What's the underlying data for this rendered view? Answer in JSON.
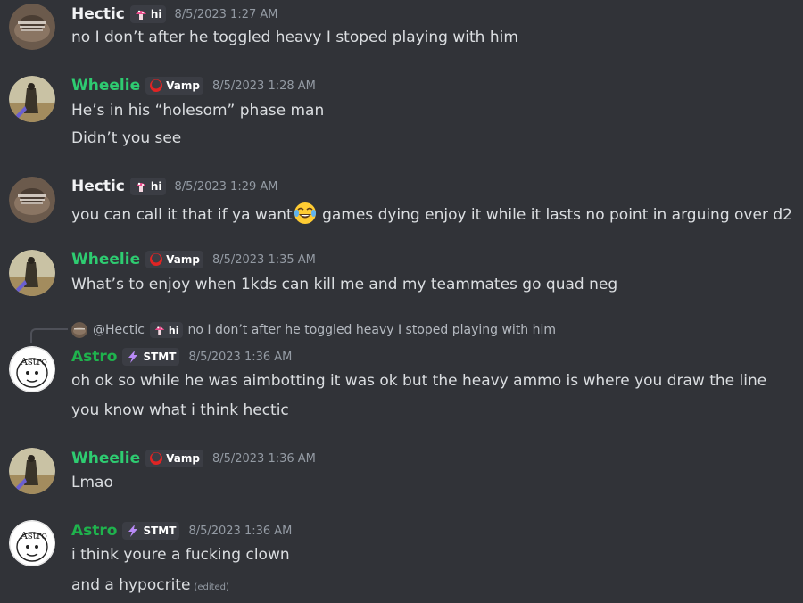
{
  "colors": {
    "background": "#313338",
    "hectic": "#f2f3f5",
    "wheelie": "#2ecc71",
    "astro": "#1fb34d",
    "text": "#dbdee1",
    "timestamp": "#949ba4"
  },
  "messages": [
    {
      "author": "Hectic",
      "role": "hi",
      "role_icon": "mushroom-icon",
      "timestamp": "8/5/2023 1:27 AM",
      "lines": [
        "no I don’t after he toggled heavy I stoped playing with him"
      ]
    },
    {
      "author": "Wheelie",
      "role": "Vamp",
      "role_icon": "vamp-icon",
      "timestamp": "8/5/2023 1:28 AM",
      "lines": [
        "He’s in his “holesom” phase man",
        "Didn’t you see"
      ]
    },
    {
      "author": "Hectic",
      "role": "hi",
      "role_icon": "mushroom-icon",
      "timestamp": "8/5/2023 1:29 AM",
      "line_before_emoji": "you can call it that if ya want",
      "emoji": "joy-emoji",
      "line_after_emoji": " games dying enjoy it while it lasts no point in arguing over d2"
    },
    {
      "author": "Wheelie",
      "role": "Vamp",
      "role_icon": "vamp-icon",
      "timestamp": "8/5/2023 1:35 AM",
      "lines": [
        "What’s to enjoy when 1kds can kill me and my teammates go quad neg"
      ]
    },
    {
      "reply": {
        "author": "@Hectic",
        "role": "hi",
        "text": "no I don’t after he toggled heavy I stoped playing with him"
      },
      "author": "Astro",
      "role": "STMT",
      "role_icon": "lightning-icon",
      "timestamp": "8/5/2023 1:36 AM",
      "lines": [
        "oh ok so while he was aimbotting it was ok but the heavy ammo is where you draw the line",
        "you know what i think hectic"
      ]
    },
    {
      "author": "Wheelie",
      "role": "Vamp",
      "role_icon": "vamp-icon",
      "timestamp": "8/5/2023 1:36 AM",
      "lines": [
        "Lmao"
      ]
    },
    {
      "author": "Astro",
      "role": "STMT",
      "role_icon": "lightning-icon",
      "timestamp": "8/5/2023 1:36 AM",
      "lines": [
        "i think youre a fucking clown",
        "and a hypocrite"
      ],
      "edited": "(edited)"
    }
  ]
}
